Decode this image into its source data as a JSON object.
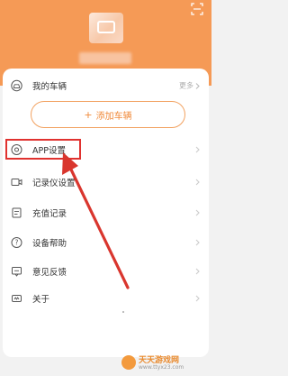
{
  "header": {
    "scan_icon": "scan-icon",
    "avatar_icon": "avatar-icon"
  },
  "vehicles": {
    "title": "我的车辆",
    "more_label": "更多",
    "add_button_label": "添加车辆",
    "add_icon": "plus"
  },
  "menu": [
    {
      "label": "APP设置",
      "icon": "gear-icon"
    },
    {
      "label": "记录仪设置",
      "icon": "camera-icon"
    },
    {
      "label": "充值记录",
      "icon": "document-icon"
    },
    {
      "label": "设备帮助",
      "icon": "help-icon"
    },
    {
      "label": "意见反馈",
      "icon": "feedback-icon"
    },
    {
      "label": "关于",
      "icon": "about-icon"
    }
  ],
  "watermark": {
    "title": "天天游戏网",
    "url": "www.ttyx23.com"
  },
  "colors": {
    "header_bg": "#f59a56",
    "accent": "#f08a3a",
    "highlight": "#e0322f",
    "background": "#f2f2f2"
  }
}
